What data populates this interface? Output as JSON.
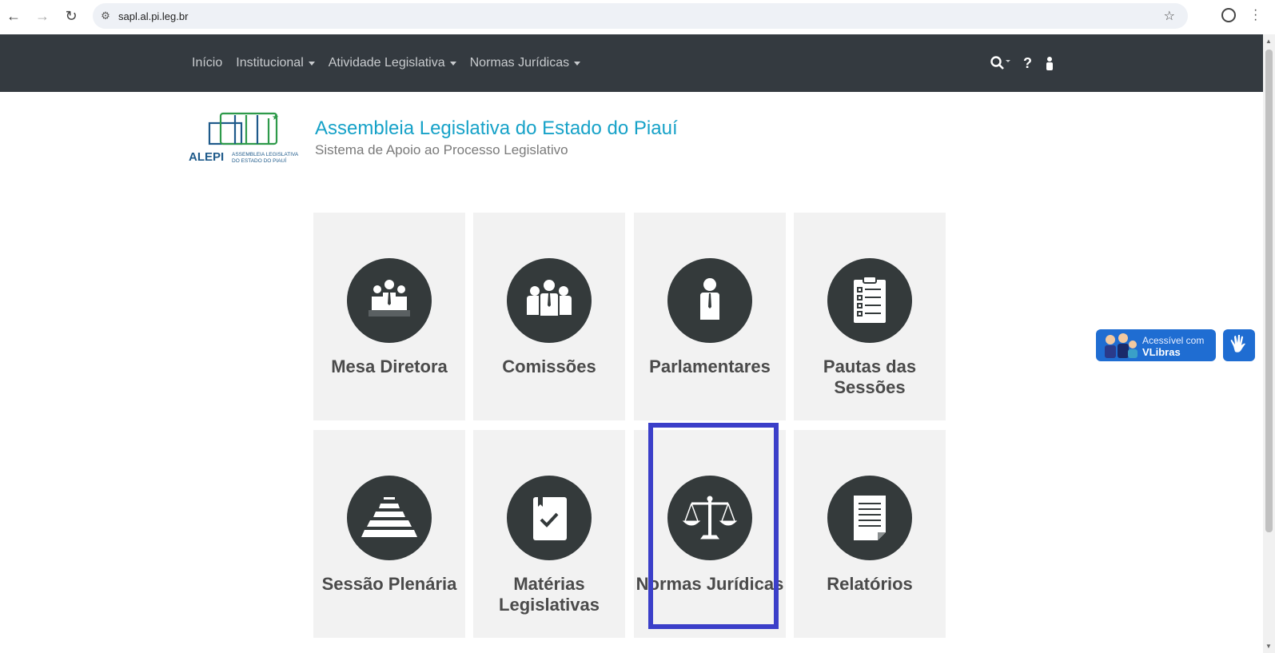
{
  "browser": {
    "url": "sapl.al.pi.leg.br"
  },
  "nav": {
    "items": [
      {
        "label": "Início",
        "dropdown": false
      },
      {
        "label": "Institucional",
        "dropdown": true
      },
      {
        "label": "Atividade Legislativa",
        "dropdown": true
      },
      {
        "label": "Normas Jurídicas",
        "dropdown": true
      }
    ],
    "help": "?"
  },
  "header": {
    "title": "Assembleia Legislativa do Estado do Piauí",
    "subtitle": "Sistema de Apoio ao Processo Legislativo",
    "logo_text": "ALEPI",
    "logo_sub1": "ASSEMBLEIA LEGISLATIVA",
    "logo_sub2": "DO ESTADO DO PIAUÍ"
  },
  "tiles": [
    {
      "label": "Mesa Diretora",
      "icon": "board-icon"
    },
    {
      "label": "Comissões",
      "icon": "group-icon"
    },
    {
      "label": "Parlamentares",
      "icon": "person-icon"
    },
    {
      "label": "Pautas das Sessões",
      "icon": "clipboard-icon"
    },
    {
      "label": "Sessão Plenária",
      "icon": "plenary-icon"
    },
    {
      "label": "Matérias Legislativas",
      "icon": "book-check-icon"
    },
    {
      "label": "Normas Jurídicas",
      "icon": "scales-icon"
    },
    {
      "label": "Relatórios",
      "icon": "report-icon"
    }
  ],
  "vlibras": {
    "line1": "Acessível com",
    "line2": "VLibras"
  },
  "colors": {
    "navbar": "#343a40",
    "title": "#17a2c8",
    "highlight": "#3b3fc9",
    "vlibras": "#1f6dd2"
  }
}
